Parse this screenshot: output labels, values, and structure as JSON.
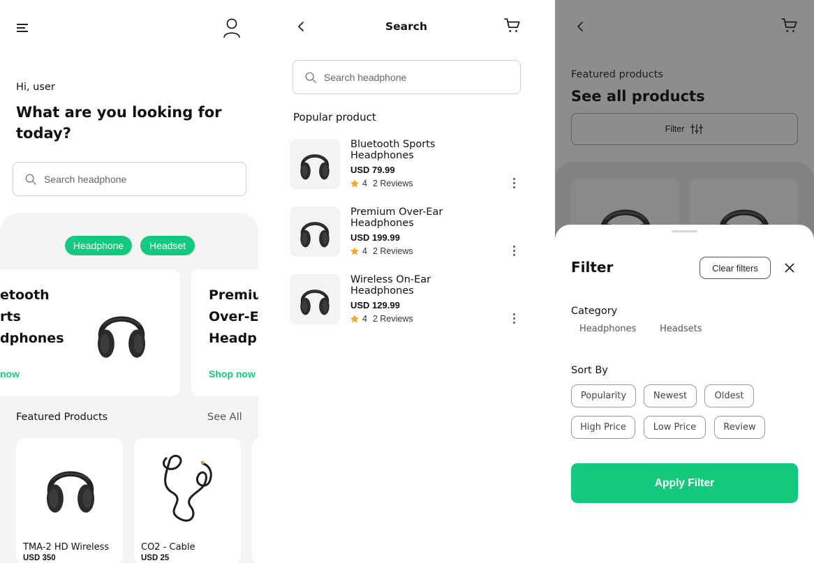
{
  "home": {
    "greeting": "Hi, user",
    "headline": "What are you looking for today?",
    "search_placeholder": "Search headphone",
    "chips": [
      "Headphone",
      "Headset"
    ],
    "banners": [
      {
        "title_lines": [
          "etooth",
          "rts",
          "dphones"
        ],
        "cta": "now"
      },
      {
        "title_lines": [
          "Premiu",
          "Over-E",
          "Headp"
        ],
        "cta": "Shop now"
      }
    ],
    "featured_title": "Featured Products",
    "see_all": "See All",
    "featured": [
      {
        "name": "TMA-2 HD Wireless",
        "price": "USD 350"
      },
      {
        "name": "CO2 - Cable",
        "price": "USD 25"
      }
    ]
  },
  "search": {
    "title": "Search",
    "search_placeholder": "Search headphone",
    "popular_title": "Popular product",
    "products": [
      {
        "name_line1": "Bluetooth Sports",
        "name_line2": "Headphones",
        "price": "USD 79.99",
        "rating": "4",
        "reviews": "2 Reviews"
      },
      {
        "name_line1": "Premium Over-Ear",
        "name_line2": "Headphones",
        "price": "USD 199.99",
        "rating": "4",
        "reviews": "2 Reviews"
      },
      {
        "name_line1": "Wireless On-Ear",
        "name_line2": "Headphones",
        "price": "USD 129.99",
        "rating": "4",
        "reviews": "2 Reviews"
      }
    ]
  },
  "filter": {
    "bg_subtitle": "Featured products",
    "bg_title": "See all products",
    "bg_filter_label": "Filter",
    "title": "Filter",
    "clear_label": "Clear filters",
    "category_title": "Category",
    "categories": [
      "Headphones",
      "Headsets"
    ],
    "sort_title": "Sort By",
    "sort_options": [
      "Popularity",
      "Newest",
      "Oldest",
      "High Price",
      "Low Price",
      "Review"
    ],
    "apply_label": "Apply Filter"
  },
  "colors": {
    "accent": "#12c97e",
    "star": "#f5a623",
    "overlay": "#8d8d8d"
  }
}
